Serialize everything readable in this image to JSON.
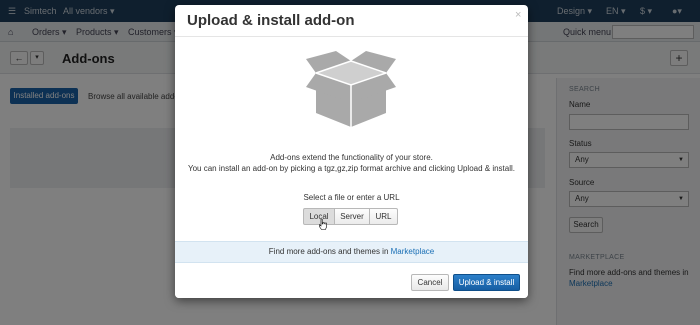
{
  "topbar": {
    "store_name": "Simtech",
    "vendors": "All vendors ▾",
    "design": "Design ▾",
    "language": "EN ▾",
    "currency": "$ ▾",
    "user_icon": "user-icon"
  },
  "navbar": {
    "home_icon": "home-icon",
    "orders": "Orders ▾",
    "products": "Products ▾",
    "customers": "Customers ▾",
    "quick_menu": "Quick menu"
  },
  "page": {
    "back_label": "←",
    "caret_label": "▾",
    "title": "Add-ons",
    "add_label": "+",
    "tab_installed": "Installed add-ons",
    "tab_browse": "Browse all available add-ons"
  },
  "sidebar": {
    "search_heading": "Search",
    "name_label": "Name",
    "status_label": "Status",
    "status_value": "Any",
    "source_label": "Source",
    "source_value": "Any",
    "search_button": "Search",
    "marketplace_heading": "Marketplace",
    "marketplace_text": "Find more add-ons and themes in",
    "marketplace_link": "Marketplace"
  },
  "modal": {
    "title": "Upload & install add-on",
    "close": "×",
    "box_icon": "open-box-icon",
    "description_line1": "Add-ons extend the functionality of your store.",
    "description_line2": "You can install an add-on by picking a tgz,gz,zip format archive and clicking Upload & install.",
    "select_prompt": "Select a file or enter a URL",
    "source_options": [
      "Local",
      "Server",
      "URL"
    ],
    "selected_source": "Local",
    "marketplace_text": "Find more add-ons and themes in",
    "marketplace_link": "Marketplace",
    "cancel_button": "Cancel",
    "upload_button": "Upload & install"
  },
  "colors": {
    "topbar_bg": "#1f3e5c",
    "primary_button": "#1a62a8",
    "marketplace_strip": "#e7f1f9",
    "link": "#1a6fb5"
  }
}
